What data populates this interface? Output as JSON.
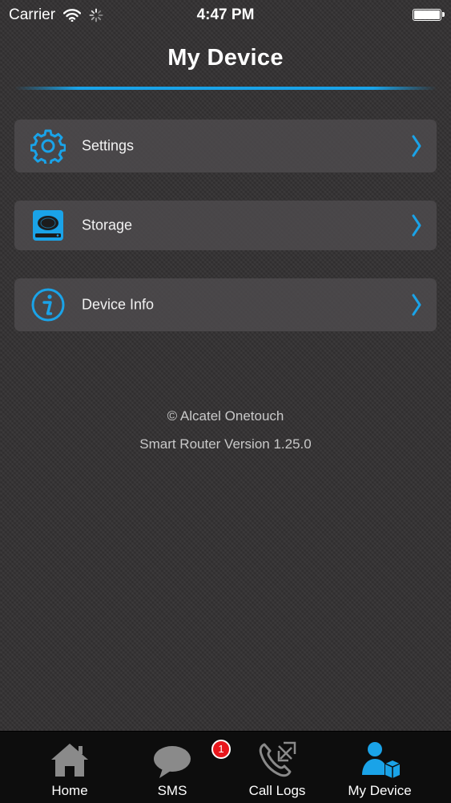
{
  "status_bar": {
    "carrier": "Carrier",
    "time": "4:47 PM"
  },
  "header": {
    "title": "My Device"
  },
  "menu": [
    {
      "label": "Settings",
      "icon": "gear-icon"
    },
    {
      "label": "Storage",
      "icon": "storage-icon"
    },
    {
      "label": "Device Info",
      "icon": "info-icon"
    }
  ],
  "footer": {
    "copyright": "© Alcatel Onetouch",
    "version": "Smart Router Version 1.25.0"
  },
  "tab_bar": {
    "tabs": [
      {
        "label": "Home",
        "icon": "home-icon"
      },
      {
        "label": "SMS",
        "icon": "chat-bubble-icon",
        "badge": "1"
      },
      {
        "label": "Call Logs",
        "icon": "phone-arrows-icon"
      },
      {
        "label": "My Device",
        "icon": "user-device-icon",
        "active": true
      }
    ]
  },
  "colors": {
    "accent": "#1aa3e8",
    "badge": "#e8161c",
    "background": "#333132"
  }
}
